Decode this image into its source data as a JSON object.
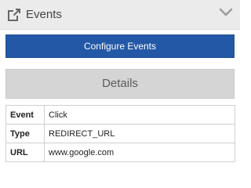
{
  "header": {
    "title": "Events",
    "leading_icon": "open-external-icon",
    "trailing_icon": "chevron-down-icon"
  },
  "actions": {
    "configure_label": "Configure Events"
  },
  "details": {
    "title": "Details",
    "rows": [
      {
        "key": "Event",
        "value": "Click"
      },
      {
        "key": "Type",
        "value": "REDIRECT_URL"
      },
      {
        "key": "URL",
        "value": "www.google.com"
      }
    ]
  },
  "colors": {
    "accent": "#2358a6",
    "header_bg": "#ebebeb",
    "details_bg": "#d5d5d5"
  }
}
